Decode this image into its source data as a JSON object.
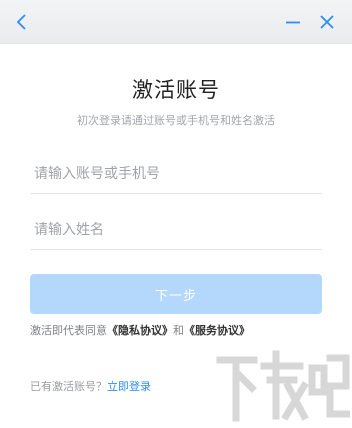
{
  "header": {
    "back_icon": "chevron-left-icon",
    "minimize_icon": "minimize-icon",
    "close_icon": "close-icon",
    "accent_color": "#2c8df6"
  },
  "main": {
    "title": "激活账号",
    "subtitle": "初次登录请通过账号或手机号和姓名激活",
    "account_placeholder": "请输入账号或手机号",
    "name_placeholder": "请输入姓名",
    "next_label": "下一步",
    "next_button_color": "#b3d8fb"
  },
  "agreement": {
    "prefix": "激活即代表同意",
    "privacy_link": "《隐私协议》",
    "and": "和",
    "service_link": "《服务协议》"
  },
  "login": {
    "prefix": "已有激活账号？",
    "link": "立即登录"
  },
  "watermark": {
    "text": "下载吧"
  }
}
